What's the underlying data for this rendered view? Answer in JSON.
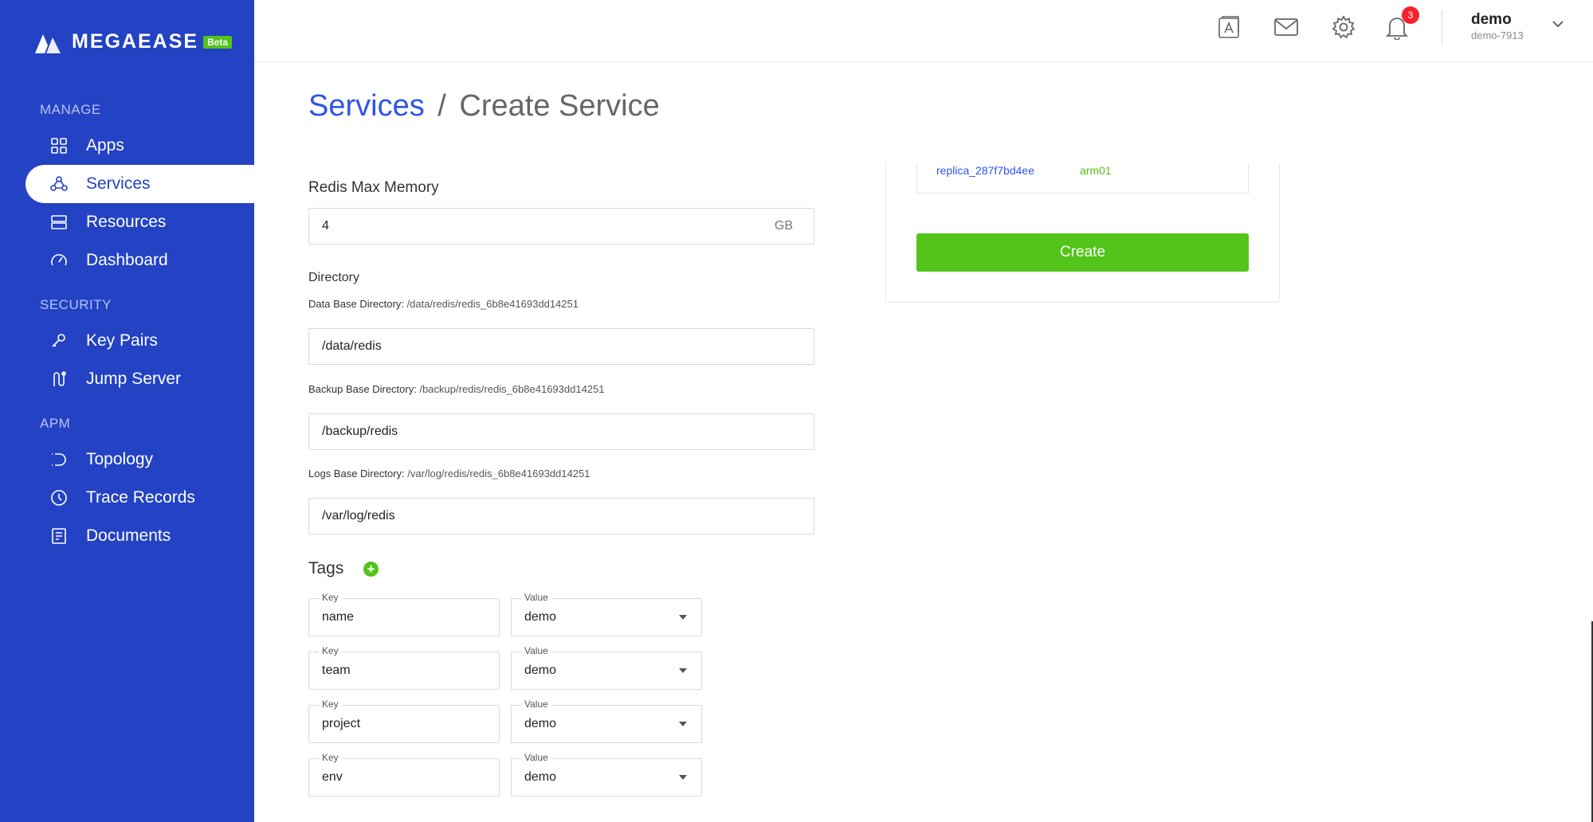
{
  "brand": {
    "name": "MEGAEASE",
    "badge": "Beta"
  },
  "sidebar": {
    "sections": [
      {
        "title": "MANAGE",
        "items": [
          {
            "label": "Apps",
            "icon": "apps-icon"
          },
          {
            "label": "Services",
            "icon": "services-icon",
            "active": true
          },
          {
            "label": "Resources",
            "icon": "resources-icon"
          },
          {
            "label": "Dashboard",
            "icon": "dashboard-icon"
          }
        ]
      },
      {
        "title": "SECURITY",
        "items": [
          {
            "label": "Key Pairs",
            "icon": "key-icon"
          },
          {
            "label": "Jump Server",
            "icon": "jump-server-icon"
          }
        ]
      },
      {
        "title": "APM",
        "items": [
          {
            "label": "Topology",
            "icon": "topology-icon"
          },
          {
            "label": "Trace Records",
            "icon": "clock-icon"
          },
          {
            "label": "Documents",
            "icon": "document-icon"
          }
        ]
      }
    ]
  },
  "header": {
    "notification_count": "3",
    "user": {
      "name": "demo",
      "id": "demo-7913"
    }
  },
  "breadcrumb": {
    "parent": "Services",
    "separator": "/",
    "current": "Create Service"
  },
  "form": {
    "max_memory": {
      "label": "Redis Max Memory",
      "value": "4",
      "unit": "GB"
    },
    "directory": {
      "label": "Directory",
      "data": {
        "label": "Data Base Directory:",
        "path": "/data/redis/redis_6b8e41693dd14251",
        "value": "/data/redis"
      },
      "backup": {
        "label": "Backup Base Directory:",
        "path": "/backup/redis/redis_6b8e41693dd14251",
        "value": "/backup/redis"
      },
      "logs": {
        "label": "Logs Base Directory:",
        "path": "/var/log/redis/redis_6b8e41693dd14251",
        "value": "/var/log/redis"
      }
    },
    "tags": {
      "title": "Tags",
      "key_label": "Key",
      "value_label": "Value",
      "rows": [
        {
          "key": "name",
          "value": "demo"
        },
        {
          "key": "team",
          "value": "demo"
        },
        {
          "key": "project",
          "value": "demo"
        },
        {
          "key": "env",
          "value": "demo"
        }
      ]
    }
  },
  "summary": {
    "replica": {
      "name": "replica_287f7bd4ee",
      "host": "arm01"
    },
    "create_label": "Create"
  }
}
